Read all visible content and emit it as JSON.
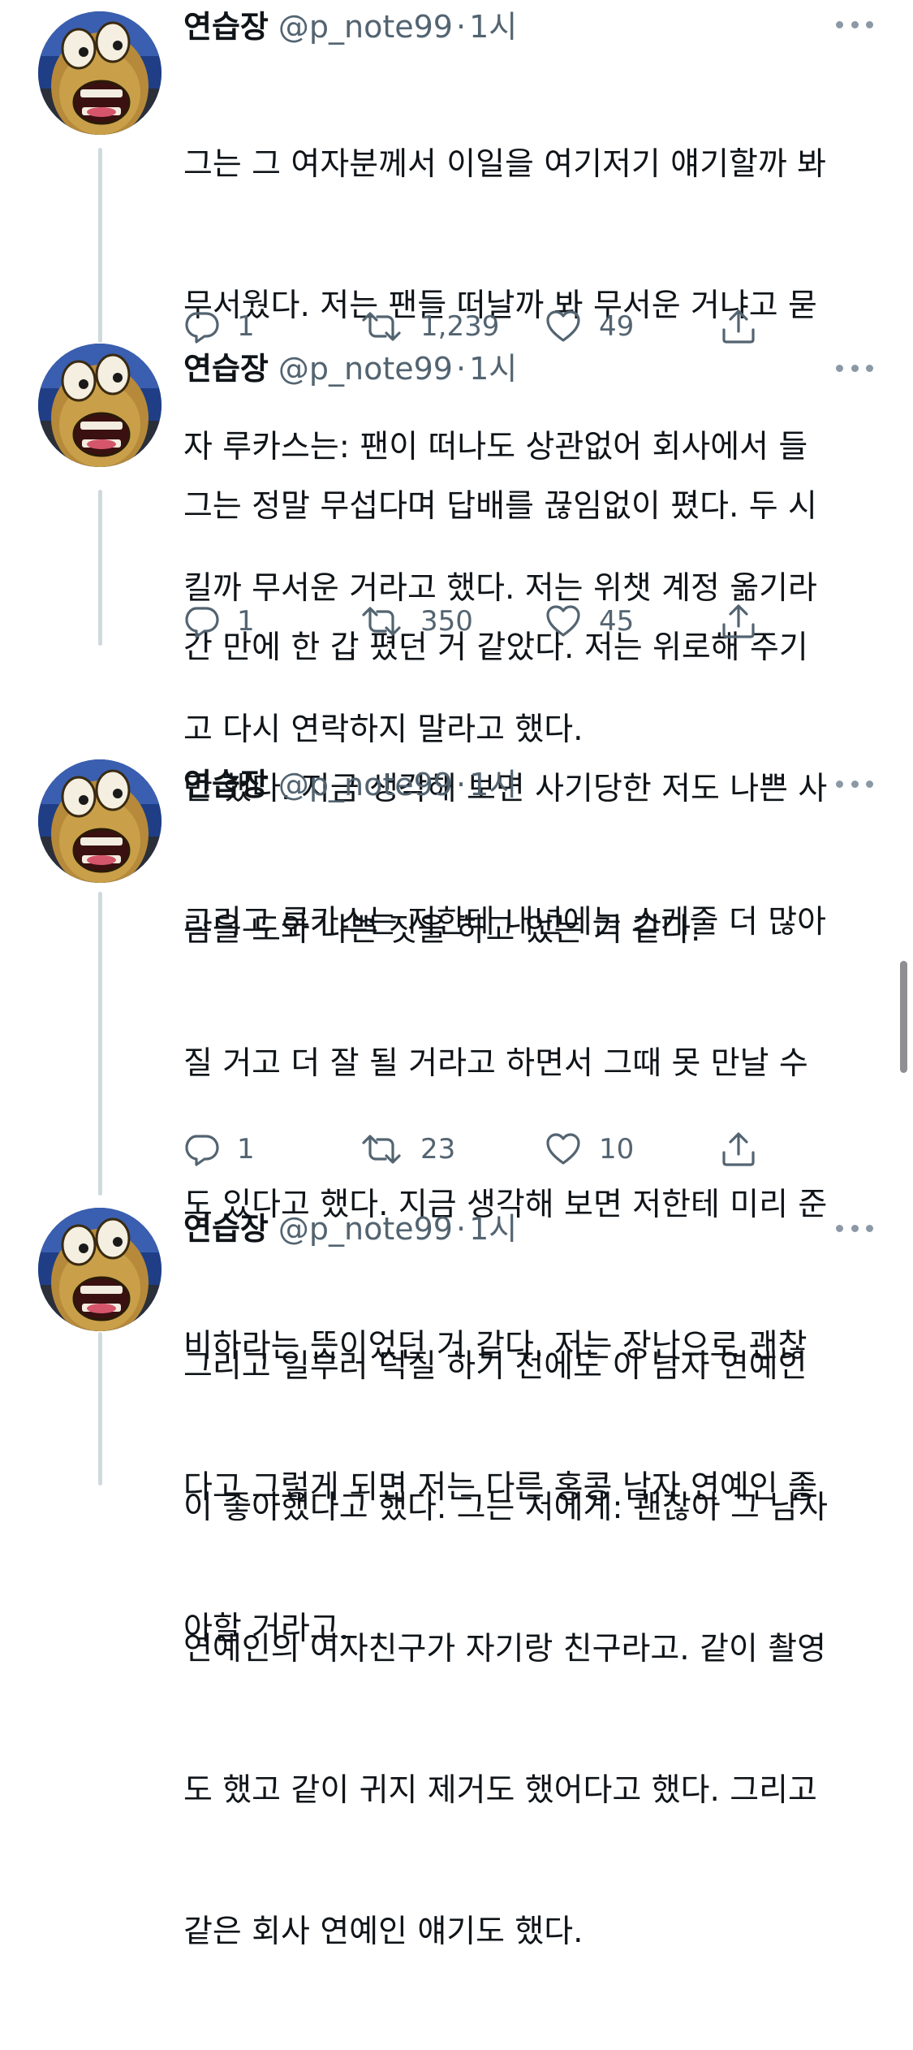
{
  "colors": {
    "text": "#0f1419",
    "secondary": "#536471",
    "thread_line": "#cfd9de",
    "scrollbar": "#8e8e93"
  },
  "tweets": [
    {
      "author": "연습장",
      "handle": "@p_note99",
      "dot": "·",
      "time": "1시",
      "lines": [
        "그는 그 여자분께서 이일을 여기저기 얘기할까 봐",
        "무서웠다. 저는 팬들 떠날까 봐 무서운 거냐고 묻",
        "자 루카스는: 팬이 떠나도 상관없어 회사에서 들",
        "킬까 무서운 거라고 했다. 저는 위챗 계정 옮기라",
        "고 다시 연락하지 말라고 했다."
      ],
      "replies": "1",
      "retweets": "1,239",
      "likes": "49"
    },
    {
      "author": "연습장",
      "handle": "@p_note99",
      "dot": "·",
      "time": "1시",
      "lines": [
        "그는 정말 무섭다며 답배를 끊임없이 폈다. 두 시",
        "간 만에 한 갑 폈던 거 같았다. 저는 위로해 주기",
        "만 했다. 지금 생각해 보면 사기당한 저도 나쁜 사",
        "람을 도와 나쁜 짓을 하고 있는 거 같다."
      ],
      "replies": "1",
      "retweets": "350",
      "likes": "45"
    },
    {
      "author": "연습장",
      "handle": "@p_note99",
      "dot": "·",
      "time": "1시",
      "lines": [
        "그리고 루카스는 저한테 내년에는 스케줄 더 많아",
        "질 거고 더 잘 될 거라고 하면서 그때 못 만날 수",
        "도 있다고 했다. 지금 생각해 보면 저한테 미리 준",
        "비하라는 뜻이었던 거 같다. 저는 장난으로 괜찮",
        "다고 그렇게 되면 저는 다른 홍콩 남자 연예인 좋",
        "아할 거라고."
      ],
      "replies": "1",
      "retweets": "23",
      "likes": "10"
    },
    {
      "author": "연습장",
      "handle": "@p_note99",
      "dot": "·",
      "time": "1시",
      "lines": [
        "그리고 일부러 덕질 하기 전에도 이 남자 연예인",
        "이 좋아했다고 했다. 그는 저에게: 괜찮아 그 남자",
        "연예인의 여자친구가 자기랑 친구라고. 같이 촬영",
        "도 했고 같이 귀지 제거도 했어다고 했다. 그리고",
        "같은 회사 연예인 얘기도 했다."
      ]
    }
  ]
}
